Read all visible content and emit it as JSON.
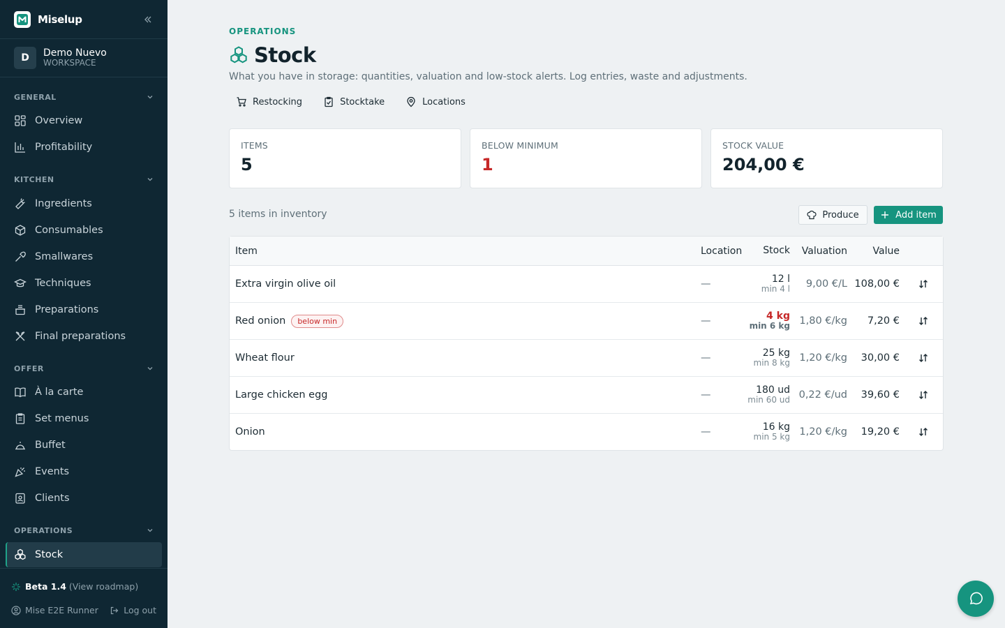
{
  "brand": {
    "name": "Miselup",
    "logo_letter": "M"
  },
  "workspace": {
    "initial": "D",
    "name": "Demo Nuevo",
    "type": "WORKSPACE"
  },
  "sidebar": {
    "sections": [
      {
        "label": "GENERAL",
        "items": [
          "Overview",
          "Profitability"
        ]
      },
      {
        "label": "KITCHEN",
        "items": [
          "Ingredients",
          "Consumables",
          "Smallwares",
          "Techniques",
          "Preparations",
          "Final preparations"
        ]
      },
      {
        "label": "OFFER",
        "items": [
          "À la carte",
          "Set menus",
          "Buffet",
          "Events",
          "Clients"
        ]
      },
      {
        "label": "OPERATIONS",
        "items": [
          "Stock"
        ]
      }
    ],
    "active_item": "Stock"
  },
  "footer": {
    "beta": "Beta 1.4",
    "roadmap": "(View roadmap)",
    "user": "Mise E2E Runner",
    "logout": "Log out"
  },
  "header": {
    "eyebrow": "OPERATIONS",
    "title": "Stock",
    "subtitle": "What you have in storage: quantities, valuation and low-stock alerts. Log entries, waste and adjustments.",
    "links": [
      "Restocking",
      "Stocktake",
      "Locations"
    ]
  },
  "cards": [
    {
      "label": "ITEMS",
      "value": "5"
    },
    {
      "label": "BELOW MINIMUM",
      "value": "1"
    },
    {
      "label": "STOCK VALUE",
      "value": "204,00 €"
    }
  ],
  "inventory": {
    "count_label": "5 items in inventory",
    "produce_label": "Produce",
    "add_label": "Add item",
    "columns": {
      "item": "Item",
      "location": "Location",
      "stock": "Stock",
      "valuation": "Valuation",
      "value": "Value"
    },
    "rows": [
      {
        "item": "Extra virgin olive oil",
        "badge": "",
        "location": "—",
        "stock": "12 l",
        "min": "min 4 l",
        "valuation": "9,00 €/L",
        "value": "108,00 €"
      },
      {
        "item": "Red onion",
        "badge": "below min",
        "location": "—",
        "stock": "4 kg",
        "min": "min 6 kg",
        "valuation": "1,80 €/kg",
        "value": "7,20 €"
      },
      {
        "item": "Wheat flour",
        "badge": "",
        "location": "—",
        "stock": "25 kg",
        "min": "min 8 kg",
        "valuation": "1,20 €/kg",
        "value": "30,00 €"
      },
      {
        "item": "Large chicken egg",
        "badge": "",
        "location": "—",
        "stock": "180 ud",
        "min": "min 60 ud",
        "valuation": "0,22 €/ud",
        "value": "39,60 €"
      },
      {
        "item": "Onion",
        "badge": "",
        "location": "—",
        "stock": "16 kg",
        "min": "min 5 kg",
        "valuation": "1,20 €/kg",
        "value": "19,20 €"
      }
    ]
  },
  "colors": {
    "sidebar_bg": "#0f2733",
    "accent": "#16947f",
    "alert": "#c62828"
  }
}
